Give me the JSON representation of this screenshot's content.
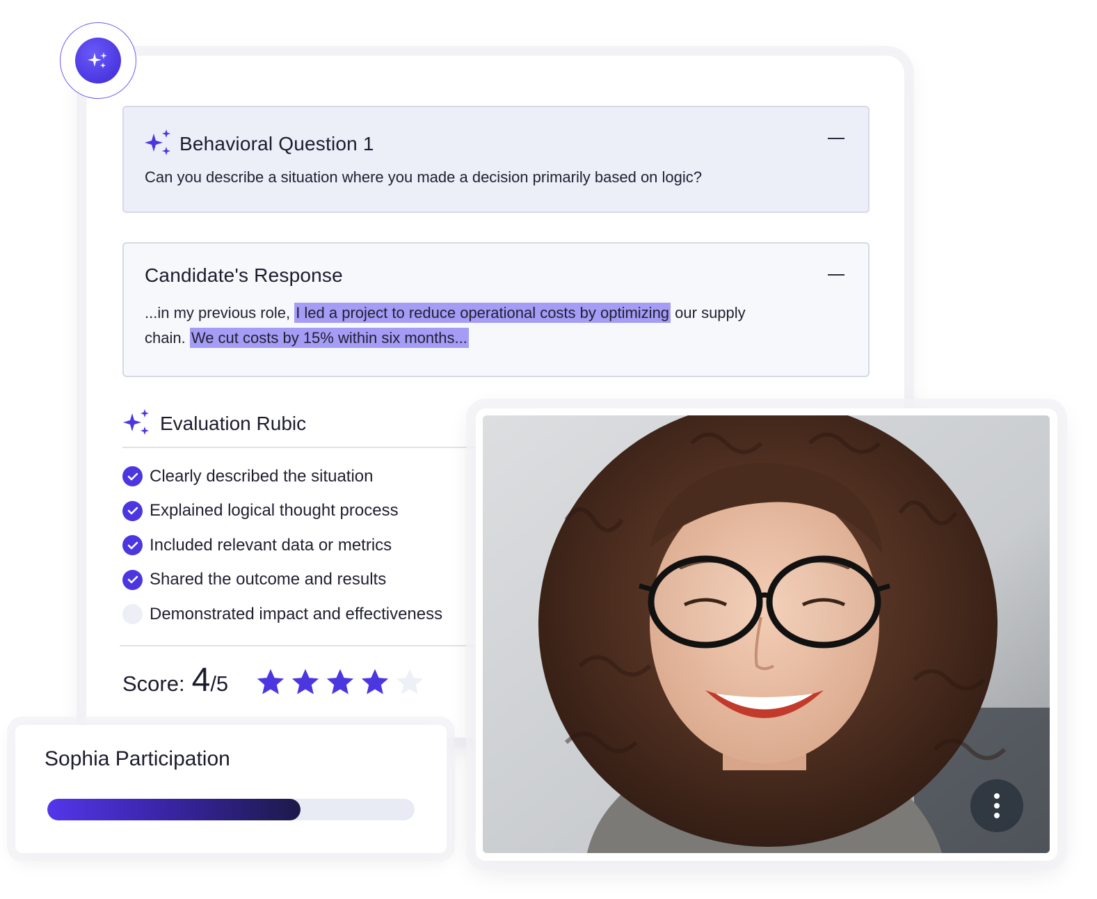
{
  "question": {
    "title": "Behavioral Question 1",
    "text": "Can you describe a situation where you made a decision primarily based on logic?",
    "icon": "sparkles-icon"
  },
  "response": {
    "title": "Candidate's Response",
    "text_before": "...in my previous role, ",
    "highlight_1": "I led a project to reduce operational costs by optimizing",
    "text_middle": " our supply chain. ",
    "highlight_2": "We cut costs by 15% within six months..."
  },
  "rubric": {
    "title": "Evaluation Rubic",
    "items": [
      {
        "label": "Clearly described the situation",
        "checked": true
      },
      {
        "label": "Explained logical thought process",
        "checked": true
      },
      {
        "label": "Included relevant data or metrics",
        "checked": true
      },
      {
        "label": "Shared the outcome and results",
        "checked": true
      },
      {
        "label": "Demonstrated impact and effectiveness",
        "checked": false
      }
    ]
  },
  "score": {
    "label": "Score:",
    "value": "4",
    "max": "/5",
    "stars_filled": 4,
    "stars_total": 5
  },
  "participation": {
    "title": "Sophia Participation",
    "progress": 0.69
  },
  "video": {
    "more_icon": "more-vertical-icon"
  },
  "colors": {
    "accent": "#4b36e0",
    "highlight": "#a59cf6",
    "star_empty": "#eef0f7"
  }
}
